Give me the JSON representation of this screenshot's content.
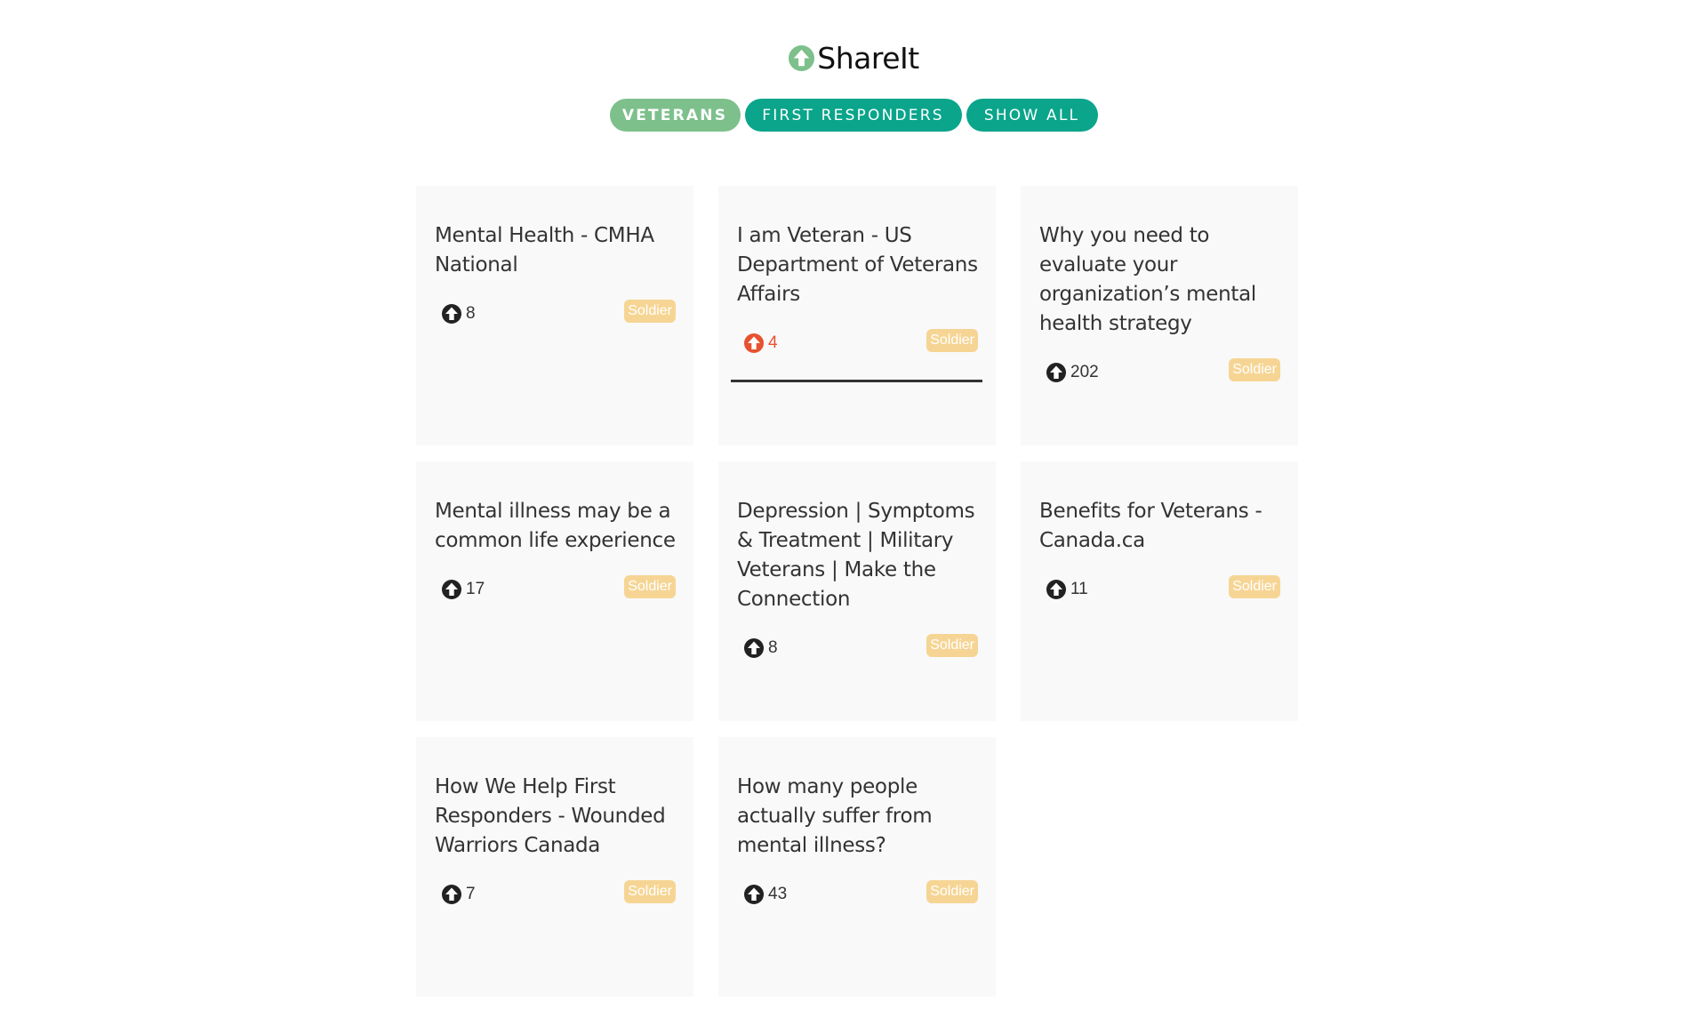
{
  "brand": {
    "name": "ShareIt"
  },
  "filters": [
    {
      "label": "VETERANS",
      "active": true
    },
    {
      "label": "FIRST RESPONDERS",
      "active": false
    },
    {
      "label": "SHOW ALL",
      "active": false
    }
  ],
  "colors": {
    "primary": "#0aa58b",
    "active_filter": "#7dc08c",
    "tag": "#f6d594",
    "hot_vote": "#e8512f",
    "card_bg": "#f9f9f9"
  },
  "cards": [
    {
      "title": "Mental Health - CMHA National",
      "votes": "8",
      "tag": "Soldier",
      "hot": false
    },
    {
      "title": "I am Veteran - US Department of Veterans Affairs",
      "votes": "4",
      "tag": "Soldier",
      "hot": true
    },
    {
      "title": "Why you need to evaluate your organization’s mental health strategy",
      "votes": "202",
      "tag": "Soldier",
      "hot": false
    },
    {
      "title": "Mental illness may be a common life experience",
      "votes": "17",
      "tag": "Soldier",
      "hot": false
    },
    {
      "title": "Depression | Symptoms & Treatment | Military Veterans | Make the Connection",
      "votes": "8",
      "tag": "Soldier",
      "hot": false
    },
    {
      "title": "Benefits for Veterans - Canada.ca",
      "votes": "11",
      "tag": "Soldier",
      "hot": false
    },
    {
      "title": "How We Help First Responders - Wounded Warriors Canada",
      "votes": "7",
      "tag": "Soldier",
      "hot": false
    },
    {
      "title": "How many people actually suffer from mental illness?",
      "votes": "43",
      "tag": "Soldier",
      "hot": false
    }
  ]
}
